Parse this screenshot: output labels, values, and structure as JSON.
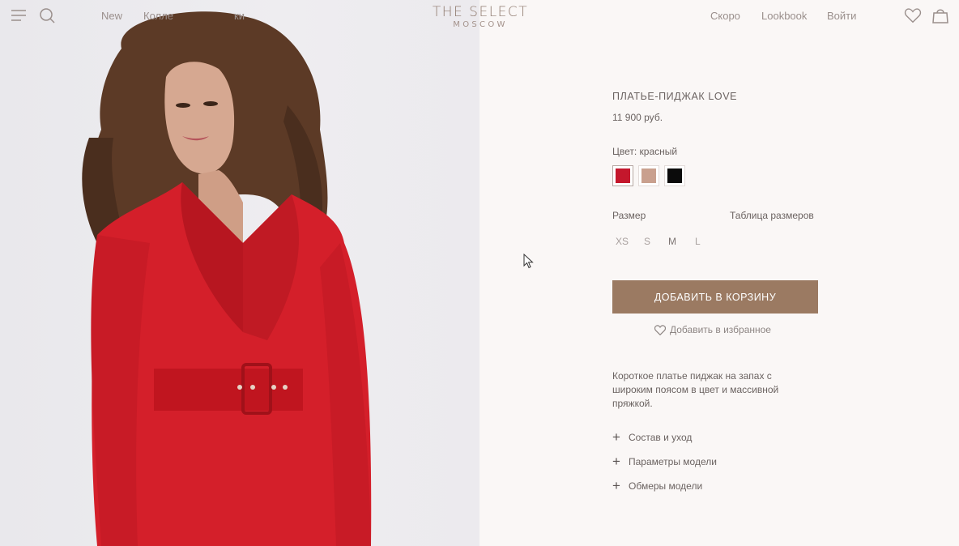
{
  "header": {
    "nav_left": [
      "New",
      "Колле",
      "ки"
    ],
    "logo_main": "THE SELECT",
    "logo_sub": "MOSCOW",
    "nav_right": [
      "Скоро",
      "Lookbook",
      "Войти"
    ]
  },
  "product": {
    "title": "ПЛАТЬЕ-ПИДЖАК LOVE",
    "price": "11 900 руб.",
    "color_label": "Цвет: красный",
    "swatches": [
      "#c4172c",
      "#c9a08e",
      "#0b0b0b"
    ],
    "size_label": "Размер",
    "size_table": "Таблица размеров",
    "sizes": [
      "XS",
      "S",
      "M",
      "L"
    ],
    "add_to_cart": "ДОБАВИТЬ В КОРЗИНУ",
    "add_to_favorites": "Добавить в избранное",
    "description": "Короткое платье пиджак на запах с широким поясом в цвет и массивной пряжкой.",
    "accordion": [
      "Состав и уход",
      "Параметры модели",
      "Обмеры модели"
    ]
  },
  "colors": {
    "accent_button": "#9b7a62",
    "logo": "#8f7a6e",
    "background": "#faf7f6"
  }
}
